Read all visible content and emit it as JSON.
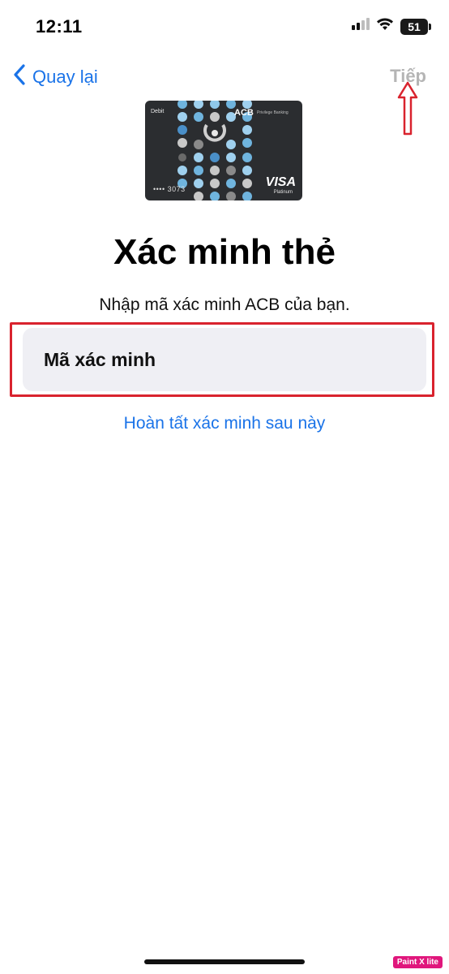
{
  "status_bar": {
    "time": "12:11",
    "battery": "51",
    "icons": [
      "signal-icon",
      "wifi-icon",
      "battery-icon"
    ]
  },
  "nav": {
    "back_label": "Quay lại",
    "next_label": "Tiếp"
  },
  "card": {
    "type_label": "Debit",
    "brand": "ACB",
    "brand_sub": "Privilege Banking",
    "number": "•••• 3073",
    "network": "VISA",
    "tier": "Platinum"
  },
  "main": {
    "title": "Xác minh thẻ",
    "subtitle": "Nhập mã xác minh ACB của bạn.",
    "code_placeholder": "Mã xác minh",
    "code_value": "",
    "later_link": "Hoàn tất xác minh sau này"
  },
  "watermark": "Paint X lite",
  "colors": {
    "accent": "#1a73e8",
    "annotation_red": "#d9232e",
    "disabled": "#b5b5b5",
    "input_bg": "#efeff4"
  }
}
